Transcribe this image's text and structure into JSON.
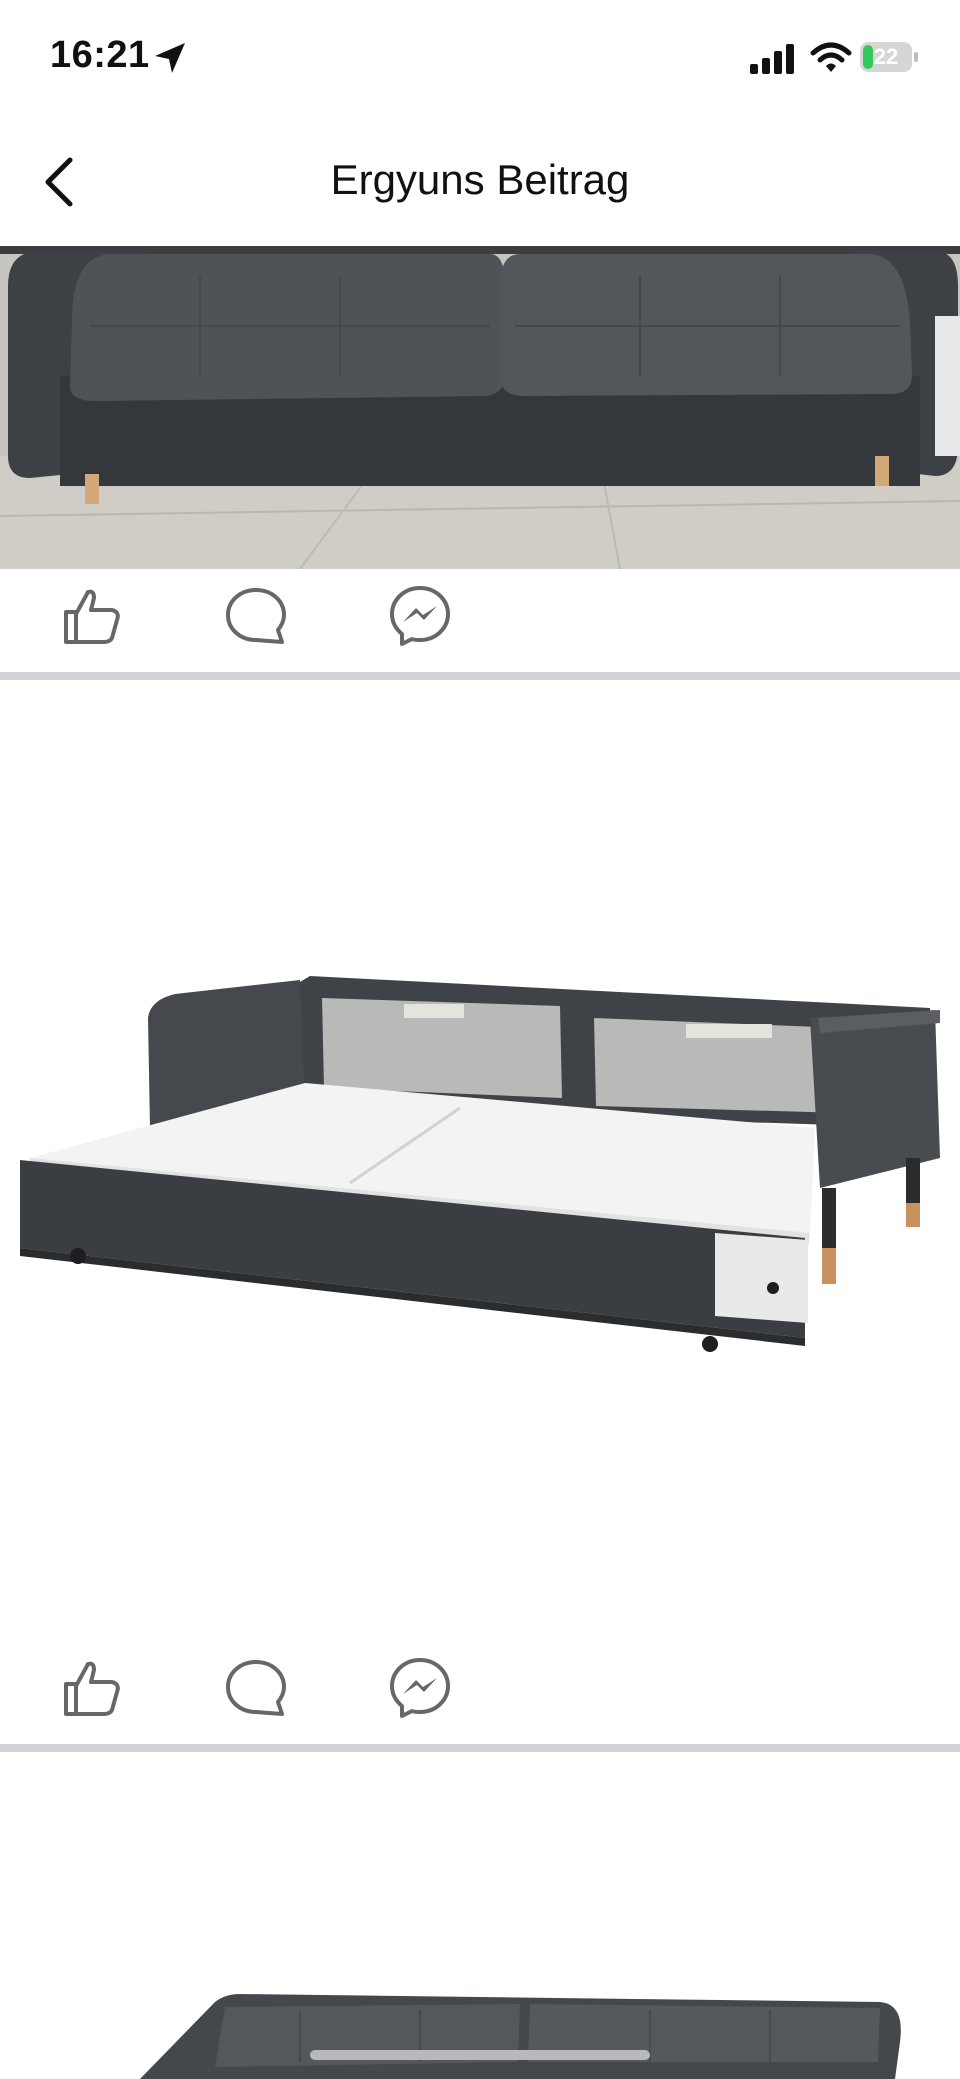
{
  "status_bar": {
    "time": "16:21",
    "battery": "22",
    "battery_level_percent": 22,
    "icons": [
      "location-arrow-icon",
      "cellular-signal-icon",
      "wifi-icon",
      "battery-charging-icon"
    ]
  },
  "nav": {
    "title": "Ergyuns Beitrag",
    "back_icon": "chevron-left-icon"
  },
  "posts": [
    {
      "image": "sofa-photo",
      "actions": [
        "like-icon",
        "comment-icon",
        "messenger-icon"
      ]
    },
    {
      "image": "sofa-bed-extended-photo",
      "actions": [
        "like-icon",
        "comment-icon",
        "messenger-icon"
      ]
    },
    {
      "image": "sofa-photo-partial"
    }
  ],
  "colors": {
    "battery_green": "#34c759",
    "divider": "#cfd2d6",
    "icon_gray": "#65676b",
    "sofa_fabric": "#3f4247"
  }
}
